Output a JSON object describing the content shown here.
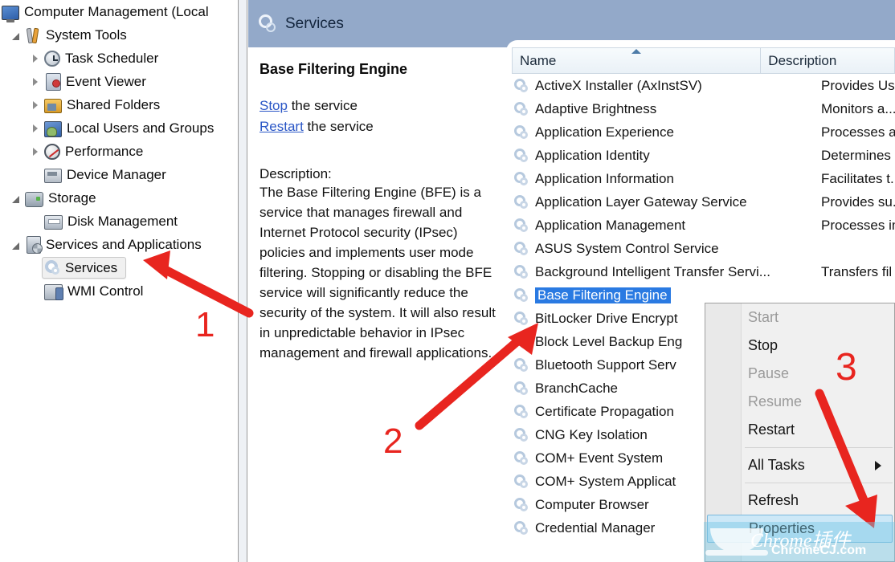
{
  "tree": {
    "root": {
      "label": "Computer Management (Local",
      "icon": "computer-icon"
    },
    "items": [
      {
        "label": "System Tools",
        "icon": "tools-icon",
        "indent": 1,
        "twisty": "expanded"
      },
      {
        "label": "Task Scheduler",
        "icon": "clock-icon",
        "indent": 2,
        "twisty": "collapsed"
      },
      {
        "label": "Event Viewer",
        "icon": "event-log-icon",
        "indent": 2,
        "twisty": "collapsed"
      },
      {
        "label": "Shared Folders",
        "icon": "shared-folder-icon",
        "indent": 2,
        "twisty": "collapsed"
      },
      {
        "label": "Local Users and Groups",
        "icon": "users-icon",
        "indent": 2,
        "twisty": "collapsed"
      },
      {
        "label": "Performance",
        "icon": "performance-icon",
        "indent": 2,
        "twisty": "collapsed"
      },
      {
        "label": "Device Manager",
        "icon": "device-manager-icon",
        "indent": 2,
        "twisty": "none"
      },
      {
        "label": "Storage",
        "icon": "storage-icon",
        "indent": 1,
        "twisty": "expanded"
      },
      {
        "label": "Disk Management",
        "icon": "disk-icon",
        "indent": 2,
        "twisty": "none"
      },
      {
        "label": "Services and Applications",
        "icon": "server-icon",
        "indent": 1,
        "twisty": "expanded"
      },
      {
        "label": "Services",
        "icon": "services-gear-icon",
        "indent": 2,
        "twisty": "none",
        "selected": true
      },
      {
        "label": "WMI Control",
        "icon": "wmi-icon",
        "indent": 2,
        "twisty": "none"
      }
    ]
  },
  "services_pane": {
    "header_title": "Services",
    "detail": {
      "service_name": "Base Filtering Engine",
      "stop_link": "Stop",
      "stop_suffix": " the service",
      "restart_link": "Restart",
      "restart_suffix": " the service",
      "description_heading": "Description:",
      "description_body": "The Base Filtering Engine (BFE) is a service that manages firewall and Internet Protocol security (IPsec) policies and implements user mode filtering. Stopping or disabling the BFE service will significantly reduce the security of the system. It will also result in unpredictable behavior in IPsec management and firewall applications."
    },
    "list": {
      "columns": [
        "Name",
        "Description"
      ],
      "sort_column": "Name",
      "sort_direction": "ascending",
      "rows": [
        {
          "name": "ActiveX Installer (AxInstSV)",
          "description": "Provides Us"
        },
        {
          "name": "Adaptive Brightness",
          "description": "Monitors a..."
        },
        {
          "name": "Application Experience",
          "description": "Processes a."
        },
        {
          "name": "Application Identity",
          "description": "Determines"
        },
        {
          "name": "Application Information",
          "description": "Facilitates t."
        },
        {
          "name": "Application Layer Gateway Service",
          "description": "Provides su."
        },
        {
          "name": "Application Management",
          "description": "Processes in"
        },
        {
          "name": "ASUS System Control Service",
          "description": ""
        },
        {
          "name": "Background Intelligent Transfer Servi...",
          "description": "Transfers fil"
        },
        {
          "name": "Base Filtering Engine",
          "description": "",
          "selected": true
        },
        {
          "name": "BitLocker Drive Encrypt",
          "description": ""
        },
        {
          "name": "Block Level Backup Eng",
          "description": ""
        },
        {
          "name": "Bluetooth Support Serv",
          "description": ""
        },
        {
          "name": "BranchCache",
          "description": ""
        },
        {
          "name": "Certificate Propagation",
          "description": ""
        },
        {
          "name": "CNG Key Isolation",
          "description": ""
        },
        {
          "name": "COM+ Event System",
          "description": ""
        },
        {
          "name": "COM+ System Applicat",
          "description": ""
        },
        {
          "name": "Computer Browser",
          "description": ""
        },
        {
          "name": "Credential Manager",
          "description": ""
        }
      ]
    }
  },
  "context_menu": {
    "items": [
      {
        "label": "Start",
        "enabled": false
      },
      {
        "label": "Stop",
        "enabled": true
      },
      {
        "label": "Pause",
        "enabled": false
      },
      {
        "label": "Resume",
        "enabled": false
      },
      {
        "label": "Restart",
        "enabled": true
      },
      {
        "separator": true
      },
      {
        "label": "All Tasks",
        "enabled": true,
        "submenu": true
      },
      {
        "separator": true
      },
      {
        "label": "Refresh",
        "enabled": true
      },
      {
        "label": "Properties",
        "enabled": true,
        "highlighted": true
      }
    ]
  },
  "annotations": {
    "step1": "1",
    "step2": "2",
    "step3": "3",
    "color": "#e8251f"
  },
  "watermark": {
    "line1": "Chrome插件",
    "line2": "ChromeCJ.com"
  }
}
